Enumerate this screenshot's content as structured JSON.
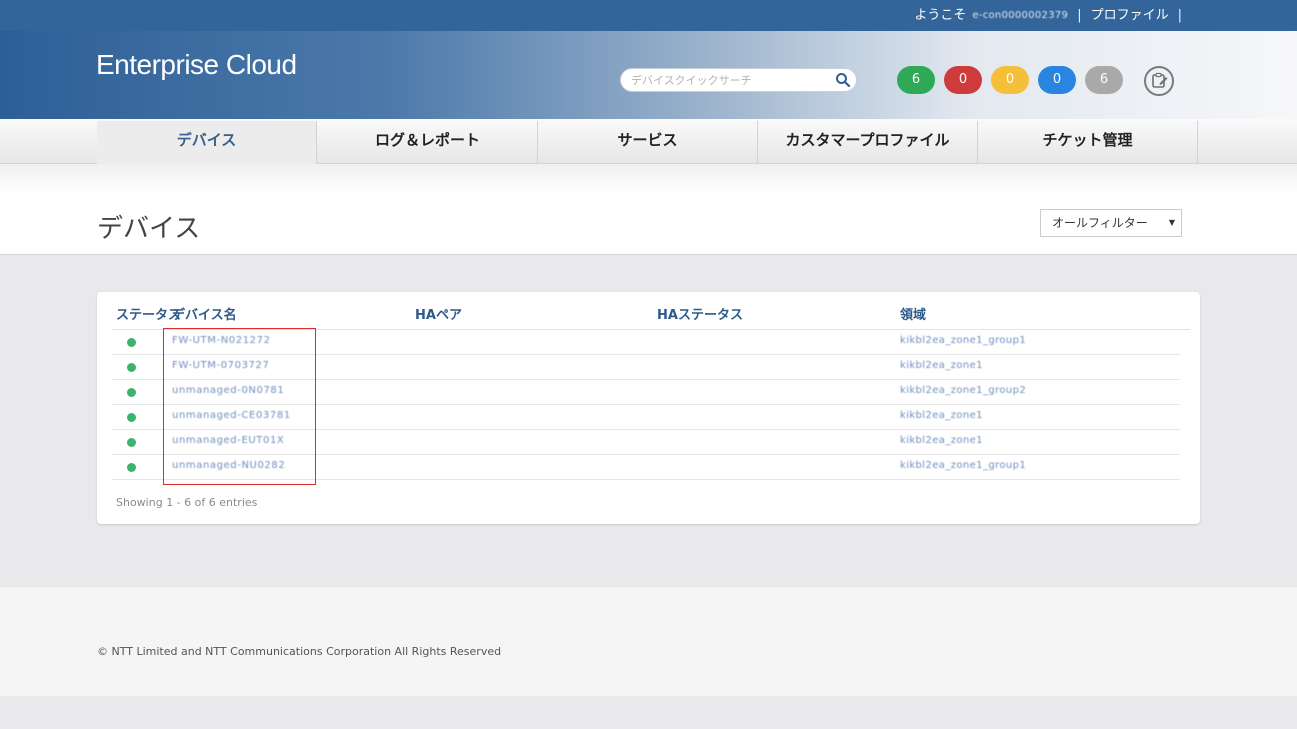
{
  "topbar": {
    "welcome": "ようこそ",
    "user": "e-con0000002379",
    "sep1": "|",
    "profile": "プロファイル",
    "sep2": "|"
  },
  "header": {
    "logo": "Enterprise Cloud",
    "search_placeholder": "デバイスクイックサーチ",
    "badges": [
      {
        "value": "6",
        "color": "#2eaa57"
      },
      {
        "value": "0",
        "color": "#cf3b3b"
      },
      {
        "value": "0",
        "color": "#f6bf3a"
      },
      {
        "value": "0",
        "color": "#2a85e0"
      },
      {
        "value": "6",
        "color": "#a9a9a9"
      }
    ]
  },
  "nav": {
    "tabs": [
      {
        "label": "デバイス"
      },
      {
        "label": "ログ＆レポート"
      },
      {
        "label": "サービス"
      },
      {
        "label": "カスタマープロファイル"
      },
      {
        "label": "チケット管理"
      }
    ]
  },
  "page": {
    "title": "デバイス",
    "filter": "オールフィルター"
  },
  "table": {
    "headers": {
      "status": "ステータス",
      "name": "デバイス名",
      "ha_pair": "HAペア",
      "ha_status": "HAステータス",
      "region": "領域"
    },
    "rows": [
      {
        "name": "FW-UTM-N021272",
        "region": "kikbl2ea_zone1_group1"
      },
      {
        "name": "FW-UTM-0703727",
        "region": "kikbl2ea_zone1"
      },
      {
        "name": "unmanaged-0N0781",
        "region": "kikbl2ea_zone1_group2"
      },
      {
        "name": "unmanaged-CE03781",
        "region": "kikbl2ea_zone1"
      },
      {
        "name": "unmanaged-EUT01X",
        "region": "kikbl2ea_zone1"
      },
      {
        "name": "unmanaged-NU0282",
        "region": "kikbl2ea_zone1_group1"
      }
    ],
    "entries": "Showing 1 - 6 of 6 entries"
  },
  "footer": {
    "copyright": "© NTT Limited and NTT Communications Corporation All Rights Reserved"
  }
}
